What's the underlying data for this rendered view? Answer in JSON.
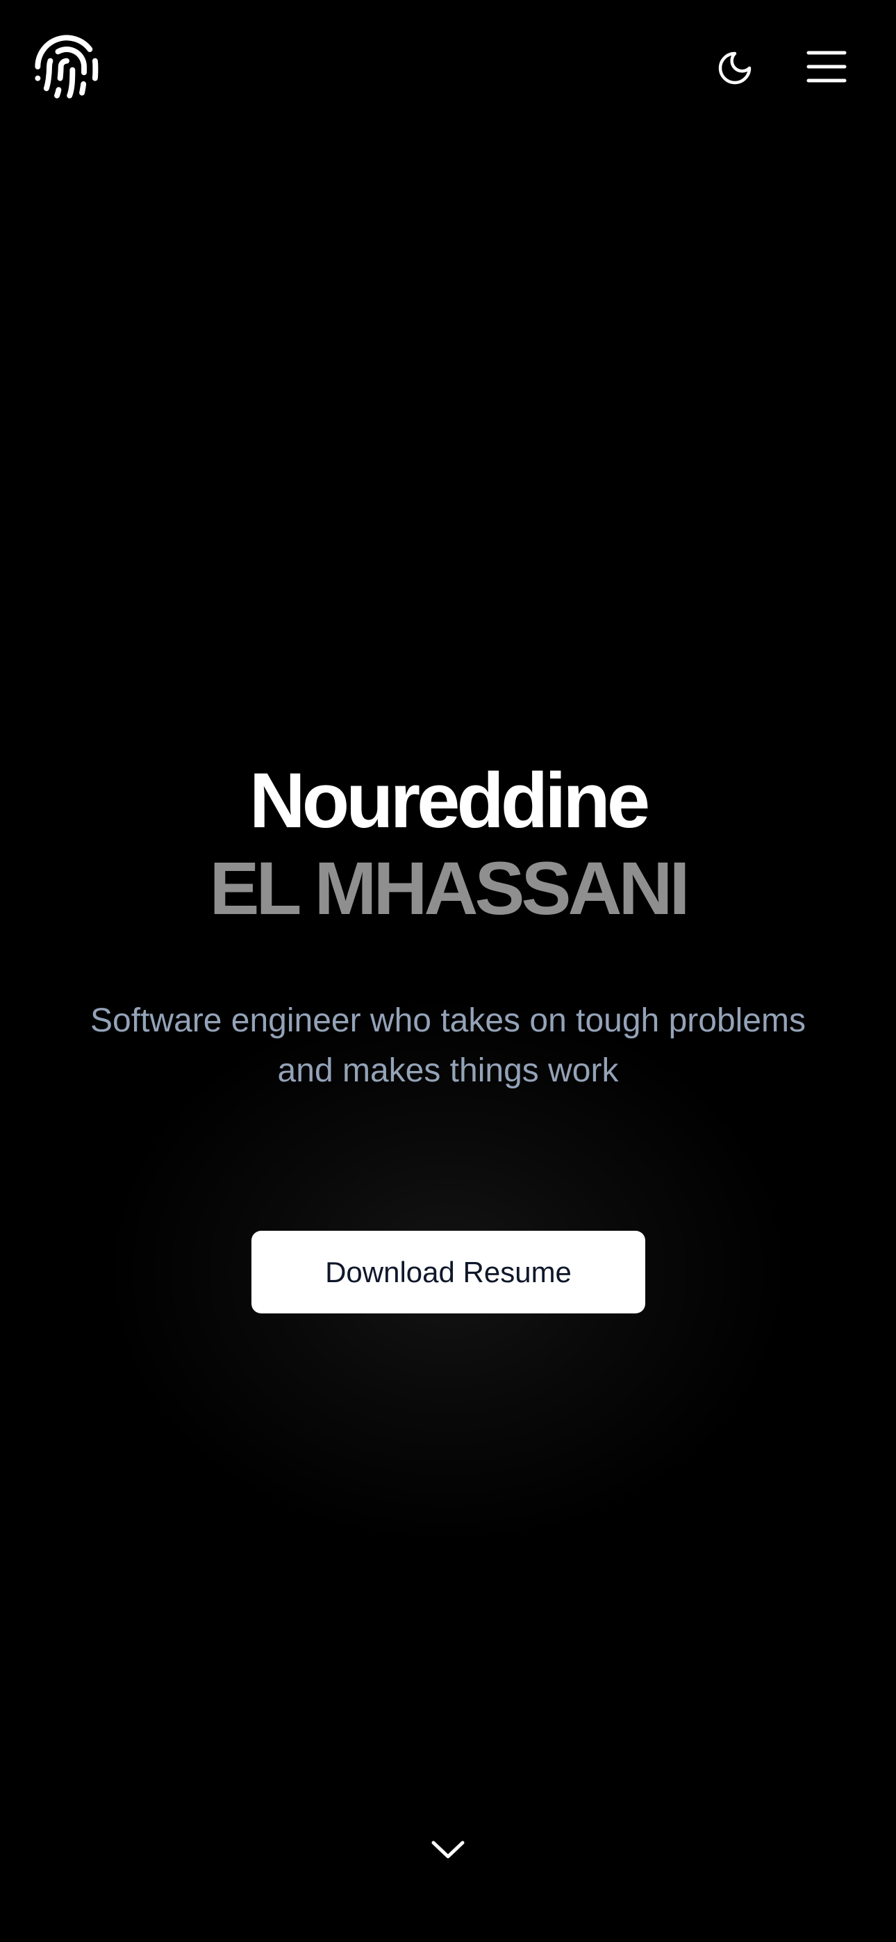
{
  "header": {
    "logo_icon": "fingerprint-icon",
    "theme_toggle_icon": "moon-icon",
    "menu_icon": "hamburger-menu-icon"
  },
  "hero": {
    "first_name": "Noureddine",
    "last_name": "EL MHASSANI",
    "tagline_line1": "Software engineer who takes on tough problems",
    "tagline_line2": "and makes things work",
    "cta_label": "Download Resume",
    "scroll_icon": "chevron-down-icon"
  },
  "colors": {
    "background": "#000000",
    "first_name": "#ffffff",
    "last_name": "#8f8f8f",
    "tagline": "#94a3b8",
    "button_bg": "#ffffff",
    "button_text": "#0f172a"
  }
}
